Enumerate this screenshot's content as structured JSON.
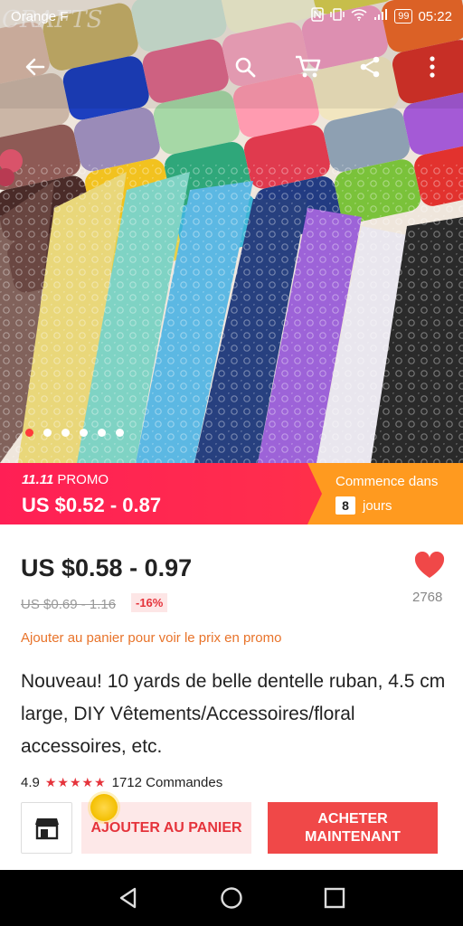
{
  "status_bar": {
    "carrier": "Orange F",
    "battery": "99",
    "time": "05:22"
  },
  "toolbar": {
    "icons": [
      "back-arrow-icon",
      "search-icon",
      "cart-icon",
      "share-icon",
      "more-vert-icon"
    ]
  },
  "hero": {
    "watermark": "CRAFTS",
    "image_count": 6,
    "active_index": 0
  },
  "promo": {
    "tag_bold": "11.11",
    "tag": "PROMO",
    "price": "US $0.52 - 0.87",
    "starts_label": "Commence dans",
    "days_value": "8",
    "days_label": "jours"
  },
  "product": {
    "price": "US $0.58 - 0.97",
    "old_price": "US $0.69 - 1.16",
    "discount": "-16%",
    "wishlist_count": "2768",
    "promo_note": "Ajouter au panier pour voir le prix en promo",
    "title": "Nouveau! 10 yards de belle dentelle ruban, 4.5 cm large, DIY Vêtements/Accessoires/floral accessoires, etc.",
    "rating": "4.9",
    "orders": "1712 Commandes"
  },
  "actions": {
    "add_to_cart": "AJOUTER AU PANIER",
    "buy_now": "ACHETER MAINTENANT"
  },
  "colors": {
    "accent_red": "#f04848",
    "promo_pink": "#ff1f55",
    "promo_orange": "#ff9a1f",
    "note_orange": "#e8732a"
  }
}
